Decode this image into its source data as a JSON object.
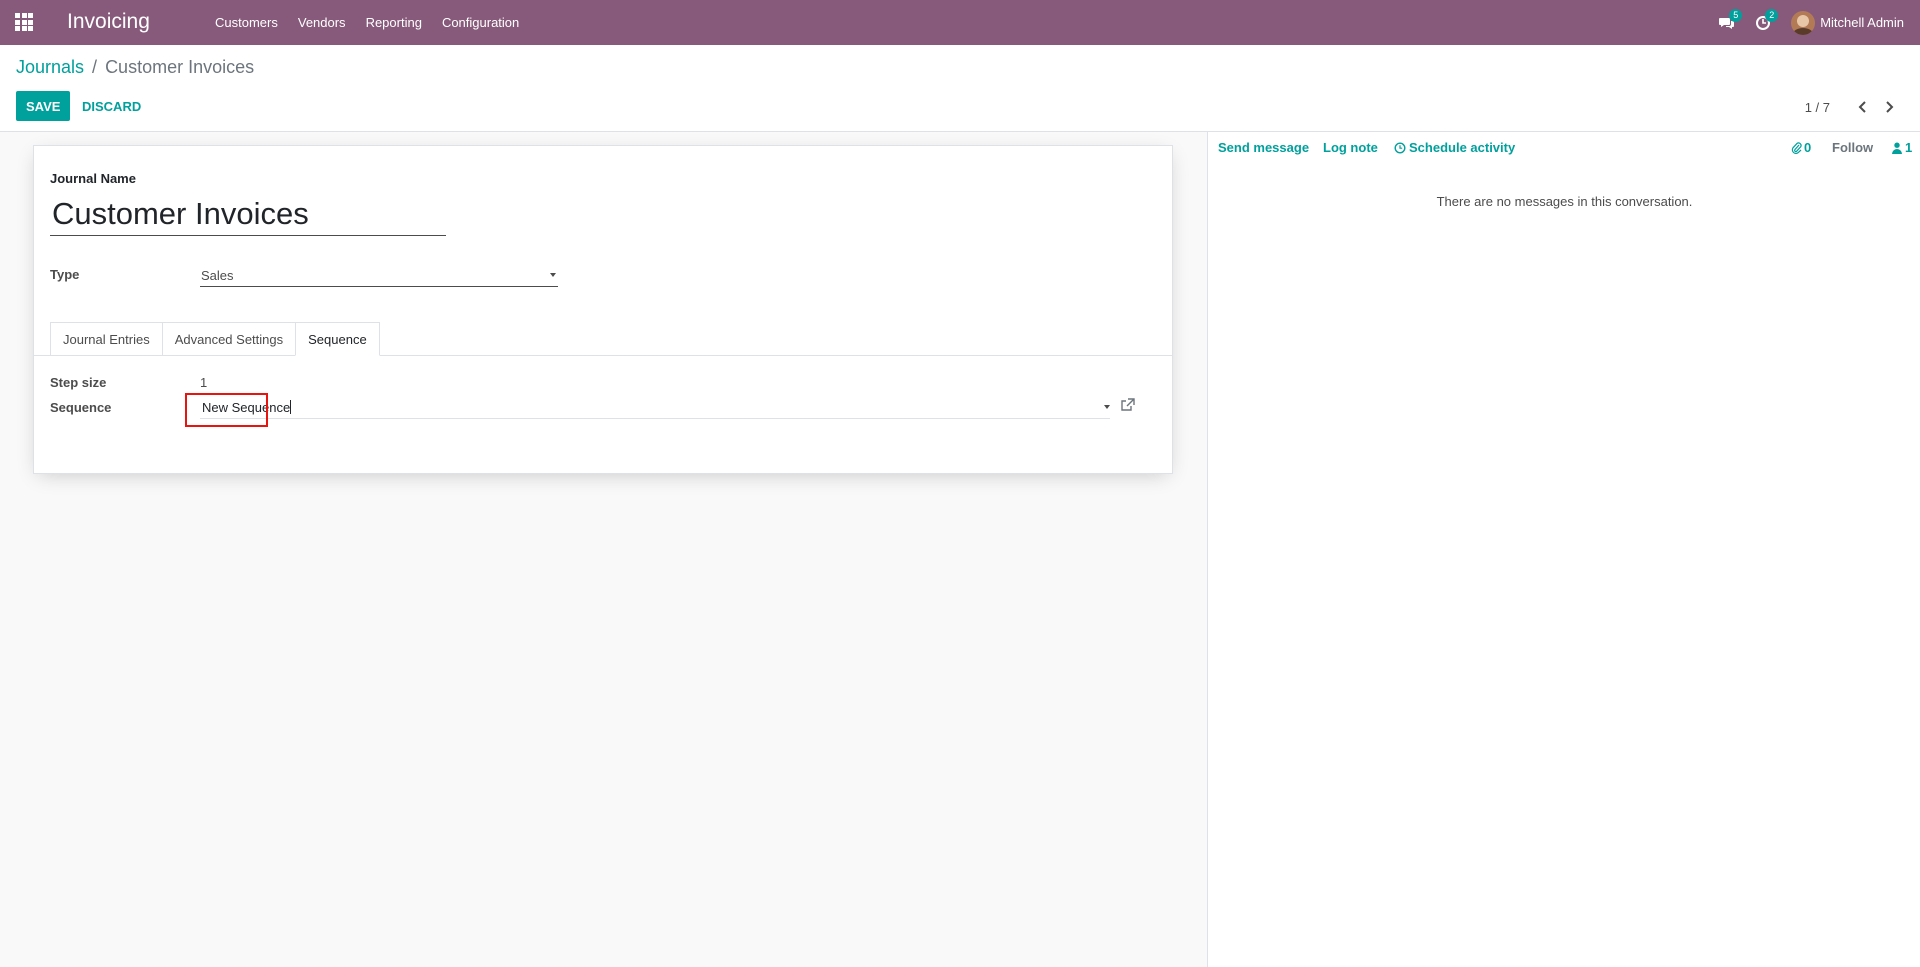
{
  "navbar": {
    "app_title": "Invoicing",
    "menu": [
      "Customers",
      "Vendors",
      "Reporting",
      "Configuration"
    ],
    "messages_count": "5",
    "activities_count": "2",
    "user_name": "Mitchell Admin"
  },
  "breadcrumb": {
    "parent": "Journals",
    "separator": "/",
    "current": "Customer Invoices"
  },
  "actions": {
    "save": "SAVE",
    "discard": "DISCARD"
  },
  "pager": {
    "value": "1 / 7"
  },
  "form": {
    "journal_name_label": "Journal Name",
    "journal_name_value": "Customer Invoices",
    "type_label": "Type",
    "type_value": "Sales",
    "tabs": [
      "Journal Entries",
      "Advanced Settings",
      "Sequence"
    ],
    "active_tab": "Sequence",
    "step_size_label": "Step size",
    "step_size_value": "1",
    "sequence_label": "Sequence",
    "sequence_value": "New Sequence"
  },
  "chatter": {
    "send_message": "Send message",
    "log_note": "Log note",
    "schedule_activity": "Schedule activity",
    "attachments_count": "0",
    "follow": "Follow",
    "followers_count": "1",
    "empty_text": "There are no messages in this conversation."
  },
  "colors": {
    "navbar": "#875a7b",
    "accent": "#00a09d",
    "highlight": "#e8140f"
  },
  "icons": [
    "apps-grid-icon",
    "chat-bubbles-icon",
    "clock-activity-icon",
    "chevron-left-icon",
    "chevron-right-icon",
    "caret-down-icon",
    "external-link-icon",
    "clock-icon",
    "paperclip-icon",
    "user-icon"
  ]
}
